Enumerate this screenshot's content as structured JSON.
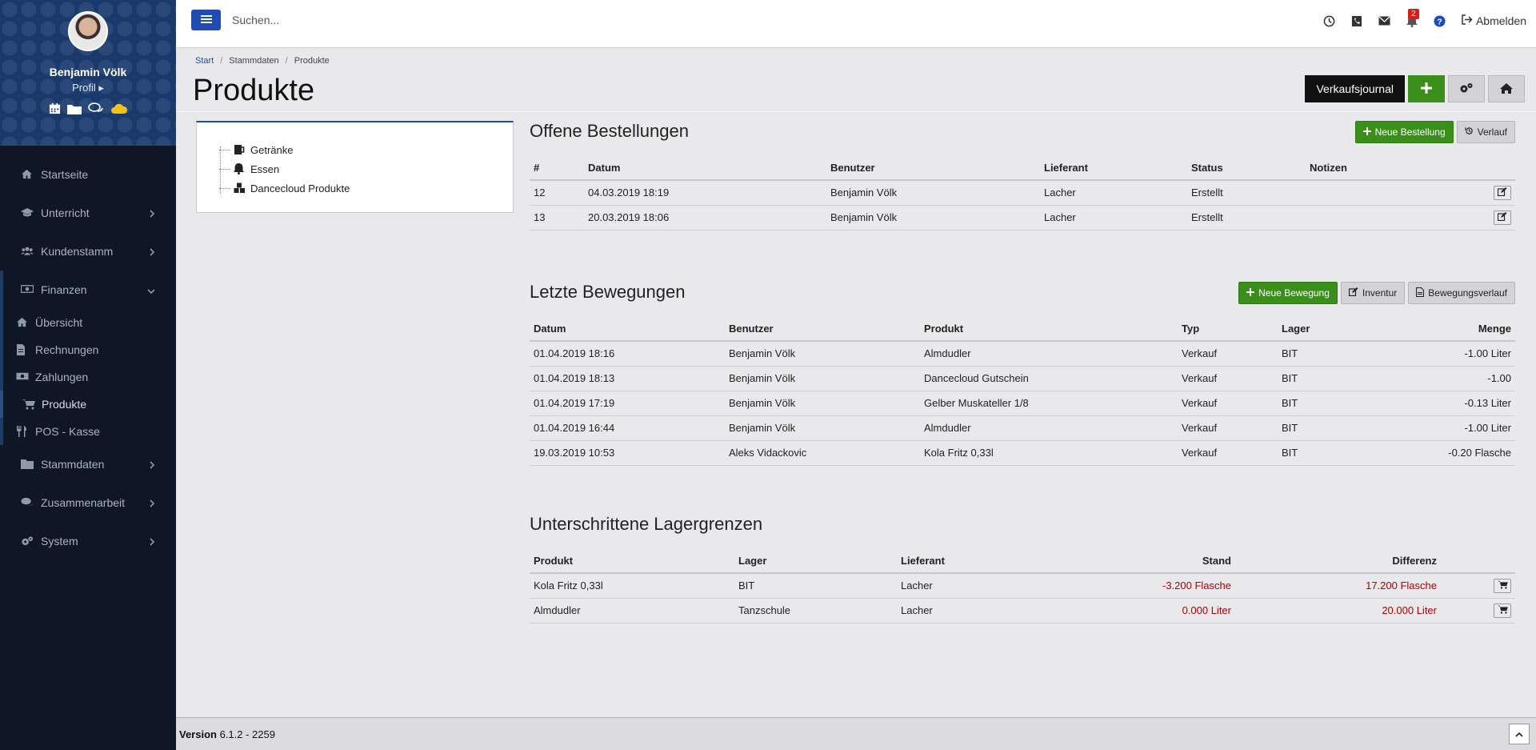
{
  "user": {
    "name": "Benjamin Völk",
    "profile_link": "Profil"
  },
  "sidebar": {
    "items": [
      {
        "label": "Startseite",
        "icon": "home-icon"
      },
      {
        "label": "Unterricht",
        "icon": "graduation-cap-icon"
      },
      {
        "label": "Kundenstamm",
        "icon": "users-icon"
      },
      {
        "label": "Finanzen",
        "icon": "money-icon"
      }
    ],
    "finance_sub": [
      {
        "label": "Übersicht",
        "icon": "home-icon"
      },
      {
        "label": "Rechnungen",
        "icon": "invoice-icon"
      },
      {
        "label": "Zahlungen",
        "icon": "money-icon"
      },
      {
        "label": "Produkte",
        "icon": "cart-icon"
      },
      {
        "label": "POS - Kasse",
        "icon": "cutlery-icon"
      }
    ],
    "items_after": [
      {
        "label": "Stammdaten",
        "icon": "folder-icon"
      },
      {
        "label": "Zusammenarbeit",
        "icon": "comments-icon"
      },
      {
        "label": "System",
        "icon": "cogs-icon"
      }
    ]
  },
  "topbar": {
    "search_placeholder": "Suchen...",
    "notification_count": "2",
    "logout_label": "Abmelden"
  },
  "breadcrumb": {
    "start": "Start",
    "stammdaten": "Stammdaten",
    "current": "Produkte"
  },
  "page_title": "Produkte",
  "header_buttons": {
    "journal": "Verkaufsjournal"
  },
  "tree": [
    {
      "label": "Getränke",
      "icon": "beer-icon"
    },
    {
      "label": "Essen",
      "icon": "bell-icon"
    },
    {
      "label": "Dancecloud Produkte",
      "icon": "cubes-icon"
    }
  ],
  "orders": {
    "title": "Offene Bestellungen",
    "new_button": "Neue Bestellung",
    "history_button": "Verlauf",
    "headers": [
      "#",
      "Datum",
      "Benutzer",
      "Lieferant",
      "Status",
      "Notizen"
    ],
    "rows": [
      [
        "12",
        "04.03.2019 18:19",
        "Benjamin Völk",
        "Lacher",
        "Erstellt",
        ""
      ],
      [
        "13",
        "20.03.2019 18:06",
        "Benjamin Völk",
        "Lacher",
        "Erstellt",
        ""
      ]
    ]
  },
  "movements": {
    "title": "Letzte Bewegungen",
    "new_button": "Neue Bewegung",
    "inventory_button": "Inventur",
    "history_button": "Bewegungsverlauf",
    "headers": [
      "Datum",
      "Benutzer",
      "Produkt",
      "Typ",
      "Lager",
      "Menge"
    ],
    "rows": [
      [
        "01.04.2019 18:16",
        "Benjamin Völk",
        "Almdudler",
        "Verkauf",
        "BIT",
        "-1.00 Liter"
      ],
      [
        "01.04.2019 18:13",
        "Benjamin Völk",
        "Dancecloud Gutschein",
        "Verkauf",
        "BIT",
        "-1.00"
      ],
      [
        "01.04.2019 17:19",
        "Benjamin Völk",
        "Gelber Muskateller 1/8",
        "Verkauf",
        "BIT",
        "-0.13 Liter"
      ],
      [
        "01.04.2019 16:44",
        "Benjamin Völk",
        "Almdudler",
        "Verkauf",
        "BIT",
        "-1.00 Liter"
      ],
      [
        "19.03.2019 10:53",
        "Aleks Vidackovic",
        "Kola Fritz 0,33l",
        "Verkauf",
        "BIT",
        "-0.20 Flasche"
      ]
    ]
  },
  "stock": {
    "title": "Unterschrittene Lagergrenzen",
    "headers": [
      "Produkt",
      "Lager",
      "Lieferant",
      "Stand",
      "Differenz"
    ],
    "rows": [
      [
        "Kola Fritz 0,33l",
        "BIT",
        "Lacher",
        "-3.200 Flasche",
        "17.200 Flasche"
      ],
      [
        "Almdudler",
        "Tanzschule",
        "Lacher",
        "0.000 Liter",
        "20.000 Liter"
      ]
    ]
  },
  "footer": {
    "version_label": "Version",
    "version": "6.1.2 - 2259"
  },
  "colors": {
    "primary": "#1e4bb4",
    "success": "#3a8f1b",
    "sidebar": "#0f1726",
    "danger": "#b00000"
  }
}
